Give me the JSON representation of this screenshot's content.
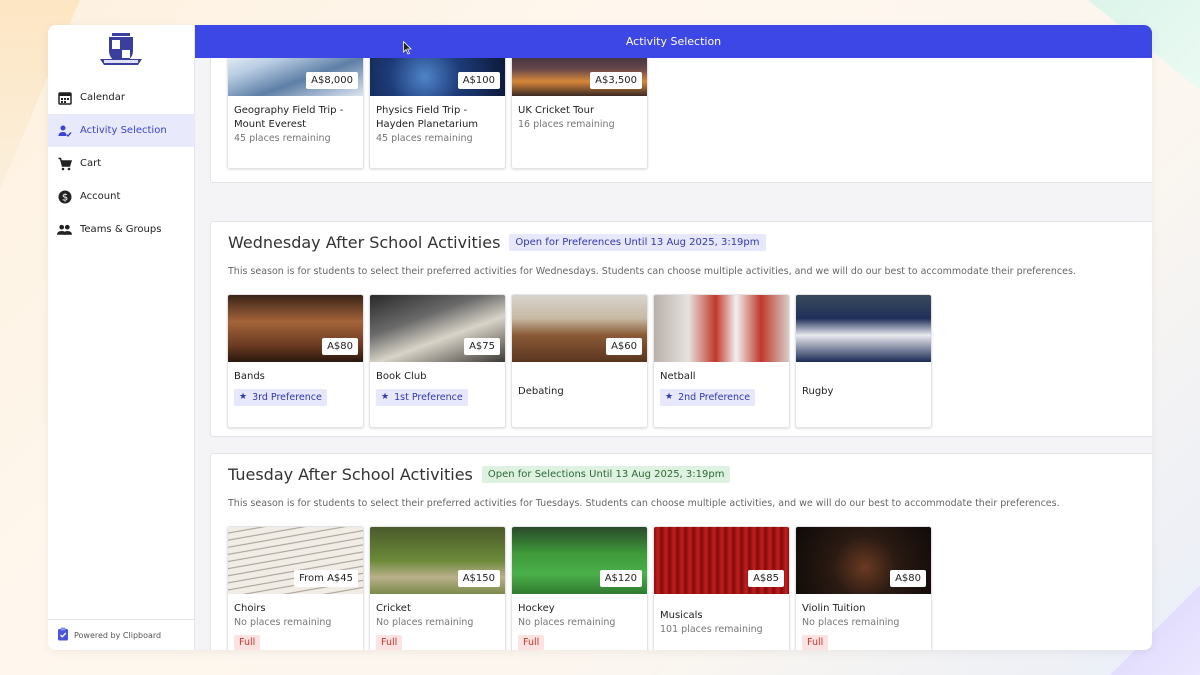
{
  "sidebar": {
    "items": [
      {
        "label": "Calendar",
        "icon": "calendar-icon"
      },
      {
        "label": "Activity Selection",
        "icon": "person-check-icon"
      },
      {
        "label": "Cart",
        "icon": "cart-icon"
      },
      {
        "label": "Account",
        "icon": "dollar-icon"
      },
      {
        "label": "Teams & Groups",
        "icon": "group-icon"
      }
    ],
    "powered_by": "Powered by Clipboard"
  },
  "header": {
    "title": "Activity Selection",
    "color": "#3d47e6"
  },
  "top_section": {
    "cards": [
      {
        "name": "Geography Field Trip - Mount Everest",
        "sub": "45 places remaining",
        "price": "A$8,000"
      },
      {
        "name": "Physics Field Trip - Hayden Planetarium",
        "sub": "45 places remaining",
        "price": "A$100"
      },
      {
        "name": "UK Cricket Tour",
        "sub": "16 places remaining",
        "price": "A$3,500"
      }
    ]
  },
  "wednesday": {
    "title": "Wednesday After School Activities",
    "badge": "Open for Preferences Until 13 Aug 2025, 3:19pm",
    "description": "This season is for students to select their preferred activities for Wednesdays. Students can choose multiple activities, and we will do our best to accommodate their preferences.",
    "cards": [
      {
        "name": "Bands",
        "price": "A$80",
        "preference": "3rd Preference"
      },
      {
        "name": "Book Club",
        "price": "A$75",
        "preference": "1st Preference"
      },
      {
        "name": "Debating",
        "price": "A$60"
      },
      {
        "name": "Netball",
        "price": "",
        "preference": "2nd Preference"
      },
      {
        "name": "Rugby",
        "price": ""
      }
    ]
  },
  "tuesday": {
    "title": "Tuesday After School Activities",
    "badge": "Open for Selections Until 13 Aug 2025, 3:19pm",
    "description": "This season is for students to select their preferred activities for Tuesdays. Students can choose multiple activities, and we will do our best to accommodate their preferences.",
    "cards": [
      {
        "name": "Choirs",
        "sub": "No places remaining",
        "price": "From A$45",
        "status": "Full"
      },
      {
        "name": "Cricket",
        "sub": "No places remaining",
        "price": "A$150",
        "status": "Full"
      },
      {
        "name": "Hockey",
        "sub": "No places remaining",
        "price": "A$120",
        "status": "Full"
      },
      {
        "name": "Musicals",
        "sub": "101 places remaining",
        "price": "A$85"
      },
      {
        "name": "Violin Tuition",
        "sub": "No places remaining",
        "price": "A$80",
        "status": "Full"
      }
    ]
  }
}
